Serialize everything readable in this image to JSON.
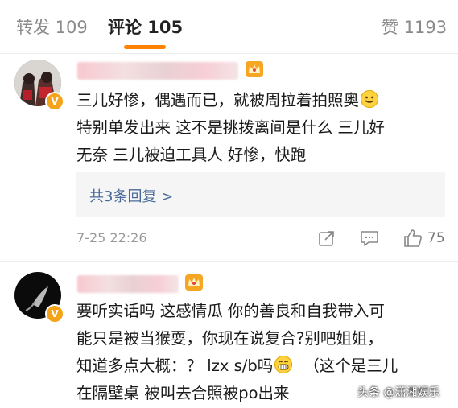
{
  "tabs": {
    "repost": "转发 109",
    "comments": "评论 105",
    "likes": "赞 1193"
  },
  "colors": {
    "accent": "#ff8200",
    "link": "#4a6a99",
    "badge": "#f4a31a"
  },
  "comments": [
    {
      "lines": [
        "三儿好惨，偶遇而已，就被周拉着拍照奥",
        "特别单发出来 这不是挑拨离间是什么 三儿好",
        "无奈 三儿被迫工具人 好惨，快跑"
      ],
      "emoji_icon": "smile-emoji",
      "replies_link": "共3条回复 >",
      "time": "7-25 22:26",
      "like_count": "75"
    },
    {
      "lines": [
        "要听实话吗 这感情瓜 你的善良和自我带入可",
        "能只是被当猴耍，你现在说复合?别吧姐姐，",
        "知道多点大概：？ lzx s/b吗",
        "在隔壁桌 被叫去合照被po出来"
      ],
      "line3_tail": "（这个是三儿",
      "emoji_icon": "grin-emoji"
    }
  ],
  "watermark": "头条 @潇湘娱乐"
}
